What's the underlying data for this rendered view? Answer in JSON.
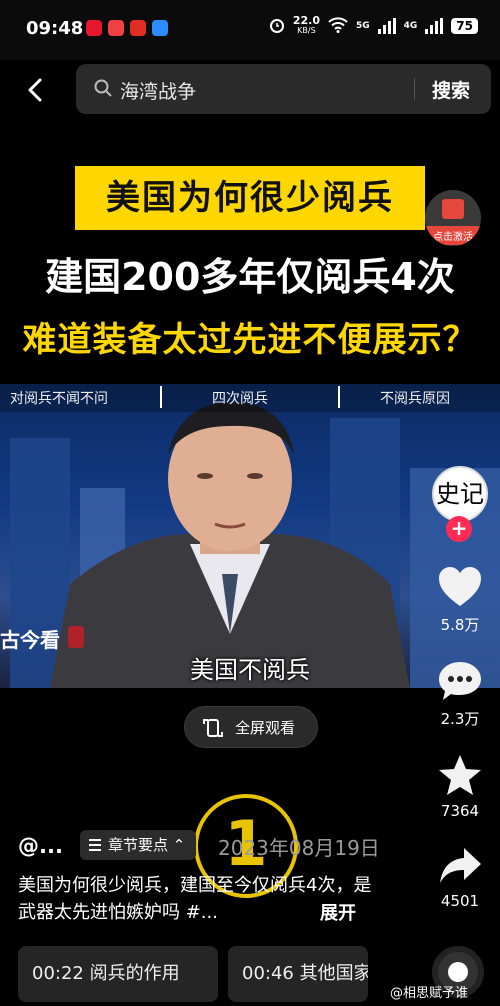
{
  "status": {
    "time": "09:48",
    "speed_value": "22.0",
    "speed_unit": "KB/S",
    "net1": "5G",
    "net2": "4G",
    "battery": "75"
  },
  "search": {
    "query": "海湾战争",
    "button": "搜索"
  },
  "overlay": {
    "title1": "美国为何很少阅兵",
    "title2": "建国200多年仅阅兵4次",
    "title3": "难道装备太过先进不便展示？",
    "promo_label": "点击激活"
  },
  "video": {
    "chapter_tabs": [
      "对阅兵不闻不问",
      "四次阅兵",
      "不阅兵原因"
    ],
    "watermark": "古今看",
    "subtitle": "美国不阅兵",
    "fullscreen_label": "全屏观看"
  },
  "actions": {
    "avatar_text": "史记",
    "likes": "5.8万",
    "comments": "2.3万",
    "favorites": "7364",
    "shares": "4501"
  },
  "info": {
    "author": "@...",
    "chapters_button": "章节要点",
    "date": "2023年08月19日",
    "badge": "1",
    "description": "美国为何很少阅兵，建国至今仅阅兵4次，是武器太先进怕嫉妒吗 #...",
    "expand": "展开",
    "chips": [
      "00:22 阅兵的作用",
      "00:46 其他国家"
    ],
    "corner_watermark": "@相思赋予谁"
  }
}
